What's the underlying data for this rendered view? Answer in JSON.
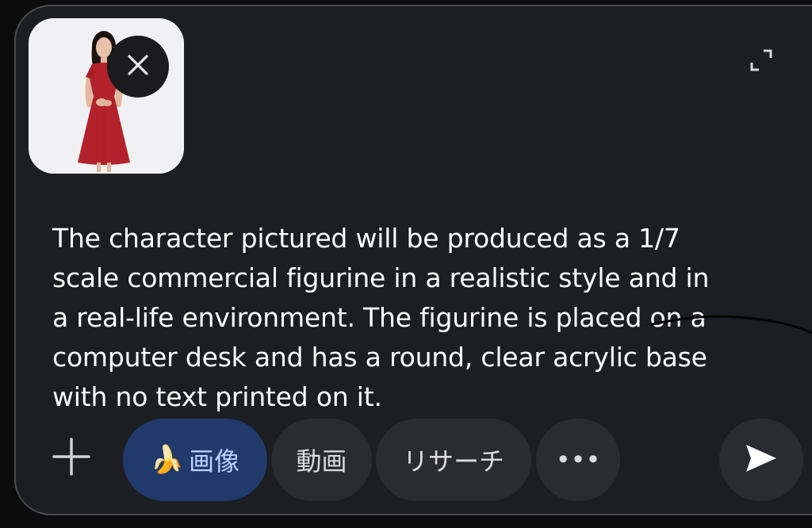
{
  "composer": {
    "prompt_text": "The character pictured will be produced as a 1/7 scale commercial figurine in a realistic style and in a real-life environment. The figurine is placed on a computer desk and has a round, clear acrylic base with no text printed on it.",
    "attachment": {
      "remove_icon": "close-icon"
    },
    "expand_icon": "expand-icon",
    "add_icon": "plus-icon",
    "send_icon": "send-icon"
  },
  "toolbar": {
    "image_chip": {
      "emoji": "🍌",
      "label": "画像",
      "active": true
    },
    "video_chip": {
      "label": "動画"
    },
    "research_chip": {
      "label": "リサーチ"
    },
    "more_chip": {
      "label": "•••"
    }
  },
  "colors": {
    "background": "#1d1e21",
    "chip": "#2b2c2f",
    "active_chip": "#1f3a6b",
    "active_chip_text": "#b9d2ff",
    "text": "#ffffff"
  }
}
